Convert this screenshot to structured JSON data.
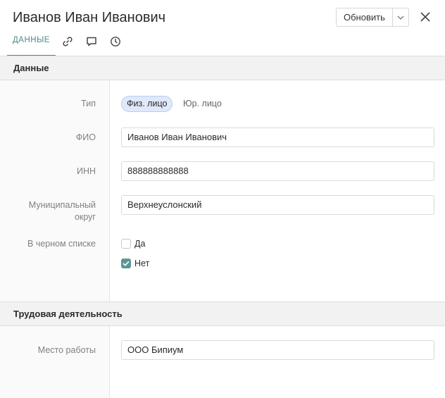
{
  "header": {
    "title": "Иванов Иван Иванович",
    "refresh_label": "Обновить"
  },
  "tabs": [
    {
      "label": "ДАННЫЕ"
    },
    {
      "icon": "link-icon"
    },
    {
      "icon": "comment-icon"
    },
    {
      "icon": "history-icon"
    }
  ],
  "sections": {
    "data": {
      "title": "Данные",
      "type": {
        "label": "Тип",
        "options": [
          "Физ. лицо",
          "Юр. лицо"
        ],
        "selected": "Физ. лицо"
      },
      "fio": {
        "label": "ФИО",
        "value": "Иванов Иван Иванович"
      },
      "inn": {
        "label": "ИНН",
        "value": "888888888888"
      },
      "district": {
        "label_line1": "Муниципальный",
        "label_line2": "округ",
        "value": "Верхнеуслонский"
      },
      "blacklist": {
        "label": "В черном списке",
        "options": [
          {
            "label": "Да",
            "checked": false
          },
          {
            "label": "Нет",
            "checked": true
          }
        ]
      }
    },
    "work": {
      "title": "Трудовая деятельность",
      "workplace": {
        "label": "Место работы",
        "value": "ООО Бипиум"
      }
    }
  },
  "colors": {
    "accent": "#4a8b8b",
    "checkbox_checked": "#5b9693",
    "chip_active_bg": "#dfe9fb"
  }
}
